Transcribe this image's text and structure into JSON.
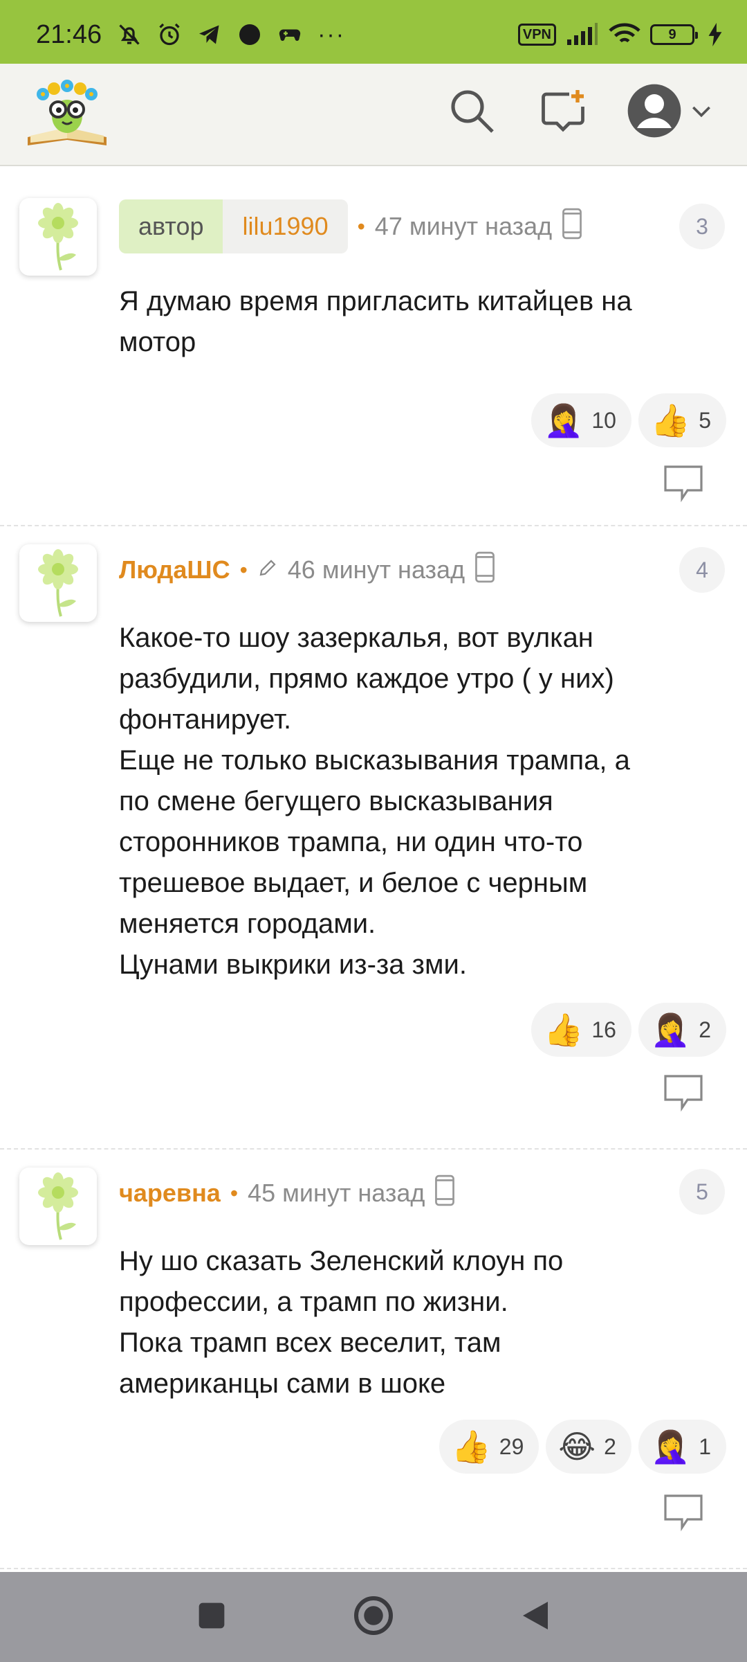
{
  "status_bar": {
    "time": "21:46",
    "left_icons": [
      "bell-off-icon",
      "alarm-icon",
      "telegram-icon",
      "dot-icon",
      "gamepad-icon",
      "more-icon"
    ],
    "more_text": "···",
    "vpn": "VPN",
    "battery_level": "9"
  },
  "header": {
    "logo_icon": "site-logo",
    "icons": [
      "search-icon",
      "new-post-icon",
      "profile-avatar-icon",
      "chevron-down-icon"
    ]
  },
  "comments": [
    {
      "author_label": "автор",
      "username": "lilu1990",
      "edited": false,
      "time": "47 минут назад",
      "number": "3",
      "text": "Я думаю время пригласить китайцев на\nмотор",
      "reactions": [
        {
          "emoji": "🤦‍♀️",
          "count": "10"
        },
        {
          "emoji": "👍",
          "count": "5"
        }
      ]
    },
    {
      "username": "ЛюдаШС",
      "edited": true,
      "time": "46 минут назад",
      "number": "4",
      "text": "Какое-то шоу зазеркалья, вот вулкан\nразбудили, прямо каждое утро ( у них)\nфонтанирует.\nЕще не только высказывания трампа, а\nпо смене бегущего высказывания\nсторонников трампа, ни один что-то\nтрешевое выдает, и белое с черным\nменяется городами.\nЦунами выкрики из-за зми.",
      "reactions": [
        {
          "emoji": "👍",
          "count": "16"
        },
        {
          "emoji": "🤦‍♀️",
          "count": "2"
        }
      ]
    },
    {
      "username": "чаревна",
      "edited": false,
      "time": "45 минут назад",
      "number": "5",
      "text": "Ну шо сказать Зеленский клоун по\nпрофессии, а трамп по жизни.\nПока трамп всех веселит, там\nамериканцы сами в шоке",
      "reactions": [
        {
          "emoji": "👍",
          "count": "29"
        },
        {
          "emoji": "😂",
          "count": "2"
        },
        {
          "emoji": "🤦‍♀️",
          "count": "1"
        }
      ]
    }
  ],
  "nav_bar": {
    "icons": [
      "recents-square-icon",
      "home-circle-icon",
      "back-triangle-icon"
    ]
  },
  "colors": {
    "status_bar": "#97c43f",
    "header_bg": "#f3f3ef",
    "username": "#e08a1e",
    "author_tag_bg": "#dff0c4",
    "nav_bar": "#9a9a9f"
  }
}
